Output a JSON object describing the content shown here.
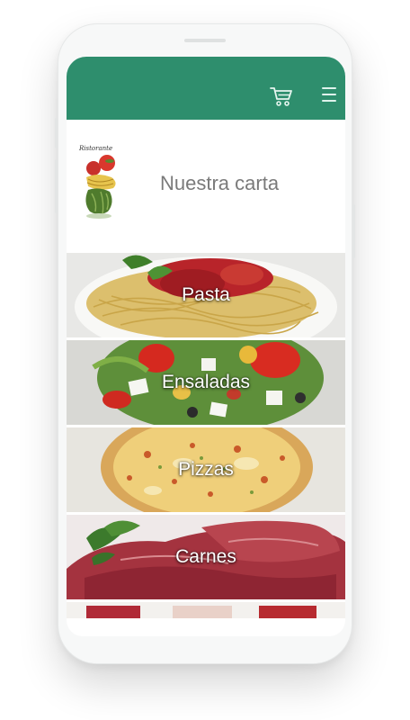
{
  "app": {
    "logo_text": "Ristorante",
    "page_title": "Nuestra carta"
  },
  "toolbar": {
    "cart_icon": "shopping-cart-icon",
    "menu_icon": "hamburger-menu-icon"
  },
  "categories": [
    {
      "label": "Pasta",
      "image": "spaghetti-plate-image"
    },
    {
      "label": "Ensaladas",
      "image": "greek-salad-image"
    },
    {
      "label": "Pizzas",
      "image": "pizza-image"
    },
    {
      "label": "Carnes",
      "image": "raw-beef-image"
    }
  ],
  "colors": {
    "appbar": "#2e8e6d",
    "title_text": "#7a7a7a",
    "label_text": "#ffffff"
  }
}
